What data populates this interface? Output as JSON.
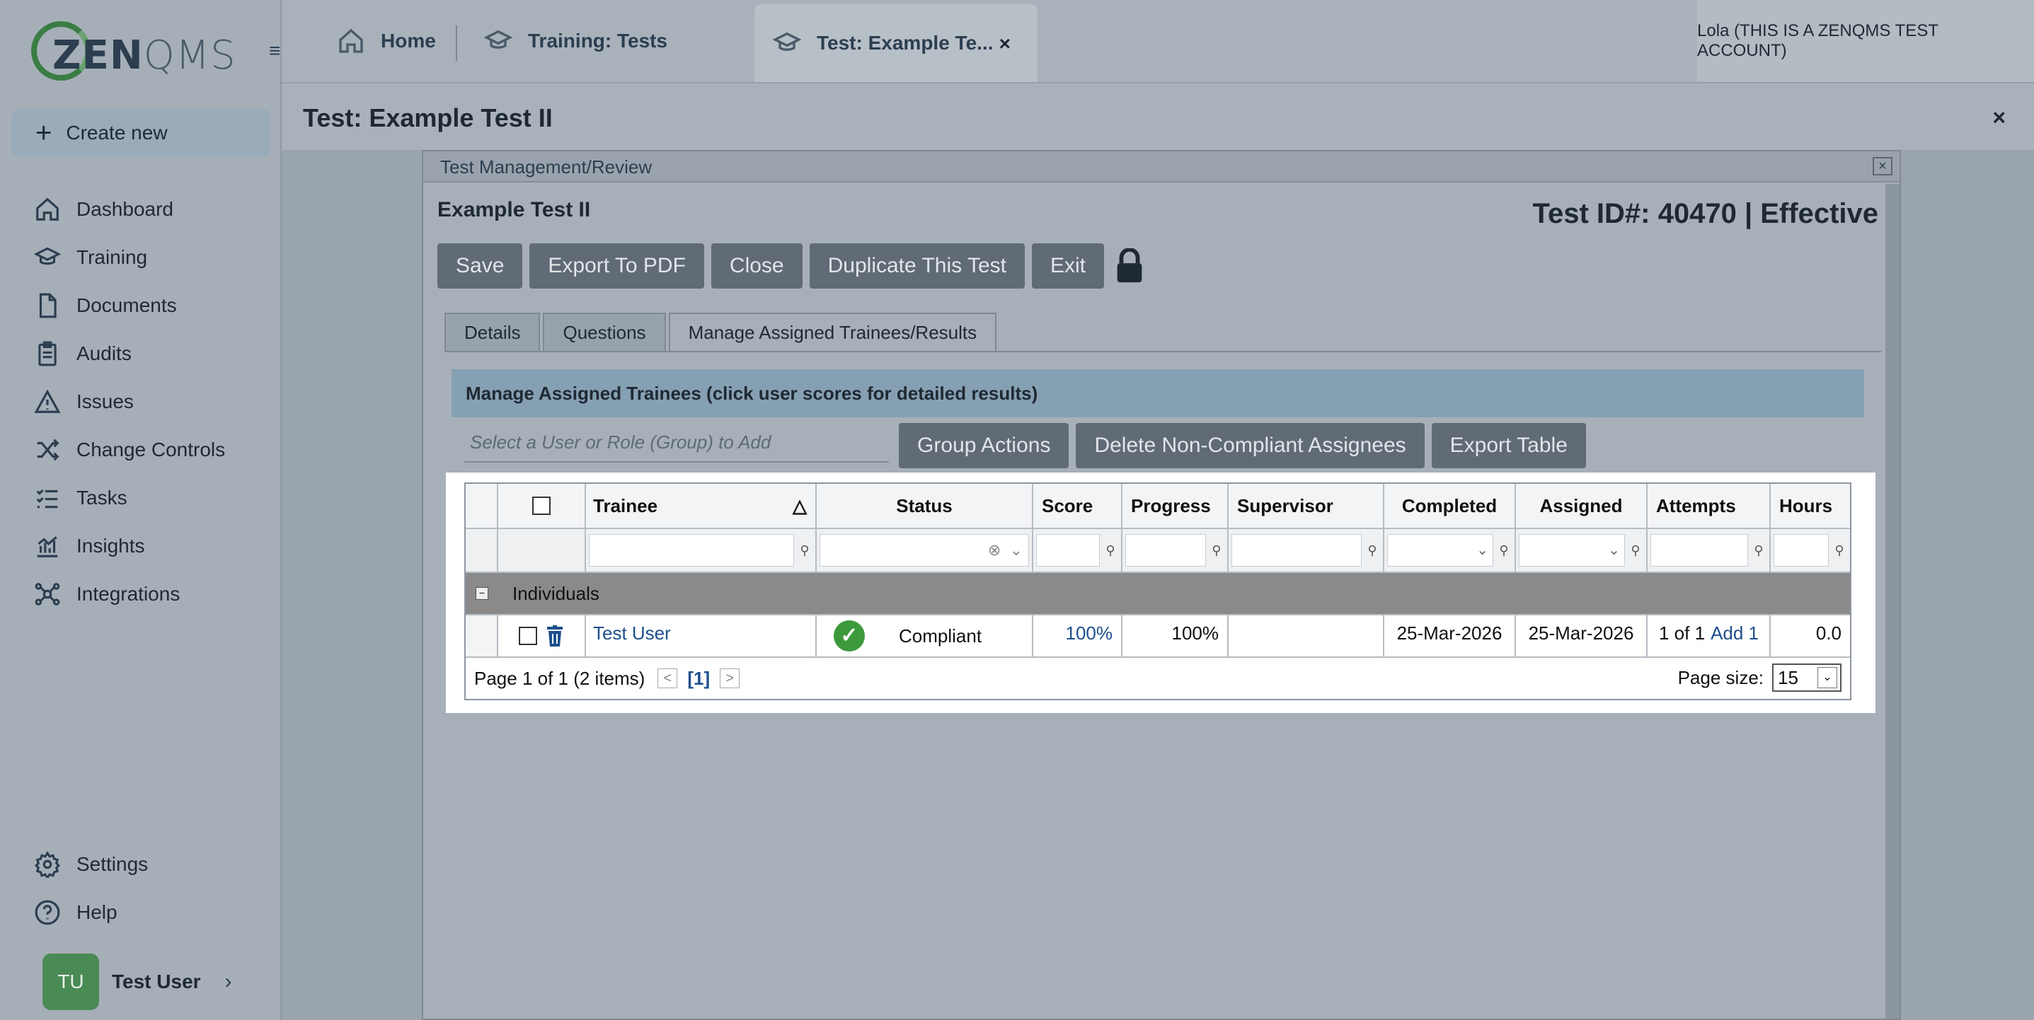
{
  "brand": {
    "logo_bold": "ZEN",
    "logo_light": "QMS"
  },
  "sidebar": {
    "create_new": "Create new",
    "items": [
      {
        "label": "Dashboard",
        "icon": "home-icon"
      },
      {
        "label": "Training",
        "icon": "graduation-cap-icon"
      },
      {
        "label": "Documents",
        "icon": "document-icon"
      },
      {
        "label": "Audits",
        "icon": "clipboard-icon"
      },
      {
        "label": "Issues",
        "icon": "warning-icon"
      },
      {
        "label": "Change Controls",
        "icon": "shuffle-icon"
      },
      {
        "label": "Tasks",
        "icon": "checklist-icon"
      },
      {
        "label": "Insights",
        "icon": "chart-icon"
      },
      {
        "label": "Integrations",
        "icon": "network-icon"
      }
    ],
    "bottom_items": [
      {
        "label": "Settings",
        "icon": "gear-icon"
      },
      {
        "label": "Help",
        "icon": "help-icon"
      }
    ],
    "user": {
      "initials": "TU",
      "name": "Test User"
    }
  },
  "topbar": {
    "tabs": [
      "Home",
      "Training: Tests",
      "Test: Example Te..."
    ],
    "close": "×",
    "account": "Lola (THIS IS A ZENQMS TEST ACCOUNT)"
  },
  "page": {
    "title": "Test: Example Test II",
    "close": "×"
  },
  "modal": {
    "title": "Test Management/Review",
    "close": "×",
    "test_name": "Example Test II",
    "test_id": "Test ID#: 40470 | Effective",
    "buttons": [
      "Save",
      "Export To PDF",
      "Close",
      "Duplicate This Test",
      "Exit"
    ],
    "tabs": [
      "Details",
      "Questions",
      "Manage Assigned Trainees/Results"
    ],
    "section_header": "Manage Assigned Trainees (click user scores for detailed results)",
    "user_select_placeholder": "Select a User or Role (Group) to Add",
    "actions": [
      "Group Actions",
      "Delete Non-Compliant Assignees",
      "Export Table"
    ]
  },
  "table": {
    "columns": [
      "",
      "",
      "Trainee",
      "Status",
      "Score",
      "Progress",
      "Supervisor",
      "Completed",
      "Assigned",
      "Attempts",
      "Hours"
    ],
    "sort_indicator": "△",
    "group_label": "Individuals",
    "group_toggle": "−",
    "row": {
      "trainee": "Test User",
      "status": "Compliant",
      "score": "100%",
      "progress": "100%",
      "supervisor": "",
      "completed": "25-Mar-2026",
      "assigned": "25-Mar-2026",
      "attempts": "1 of 1",
      "attempts_add": "Add 1",
      "hours": "0.0"
    },
    "pager": {
      "summary": "Page 1 of 1 (2 items)",
      "prev": "<",
      "current": "[1]",
      "next": ">",
      "page_size_label": "Page size:",
      "page_size": "15"
    }
  }
}
